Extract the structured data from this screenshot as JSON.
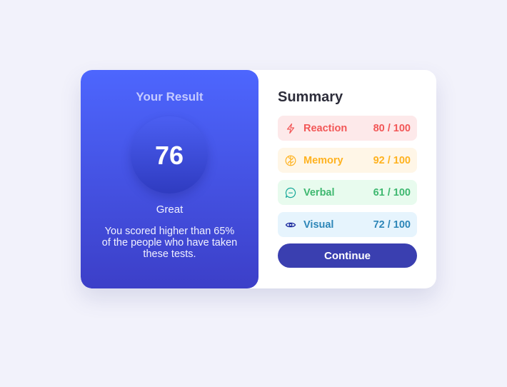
{
  "result": {
    "title": "Your Result",
    "score": "76",
    "rating": "Great",
    "description": "You scored higher than 65% of the people who have taken these tests."
  },
  "summary": {
    "title": "Summary",
    "items": [
      {
        "label": "Reaction",
        "score": "80 / 100",
        "icon": "lightning-icon",
        "text_color": "#f25757",
        "bg_color": "#fde9ea"
      },
      {
        "label": "Memory",
        "score": "92 / 100",
        "icon": "brain-icon",
        "text_color": "#ffb21f",
        "bg_color": "#fff6e7"
      },
      {
        "label": "Verbal",
        "score": "61 / 100",
        "icon": "chat-bubble-icon",
        "text_color": "#3fb870",
        "bg_color": "#e8fbee"
      },
      {
        "label": "Visual",
        "score": "72 / 100",
        "icon": "eye-icon",
        "text_color": "#2d86b8",
        "bg_color": "#e6f4fd"
      }
    ],
    "continue_label": "Continue"
  }
}
